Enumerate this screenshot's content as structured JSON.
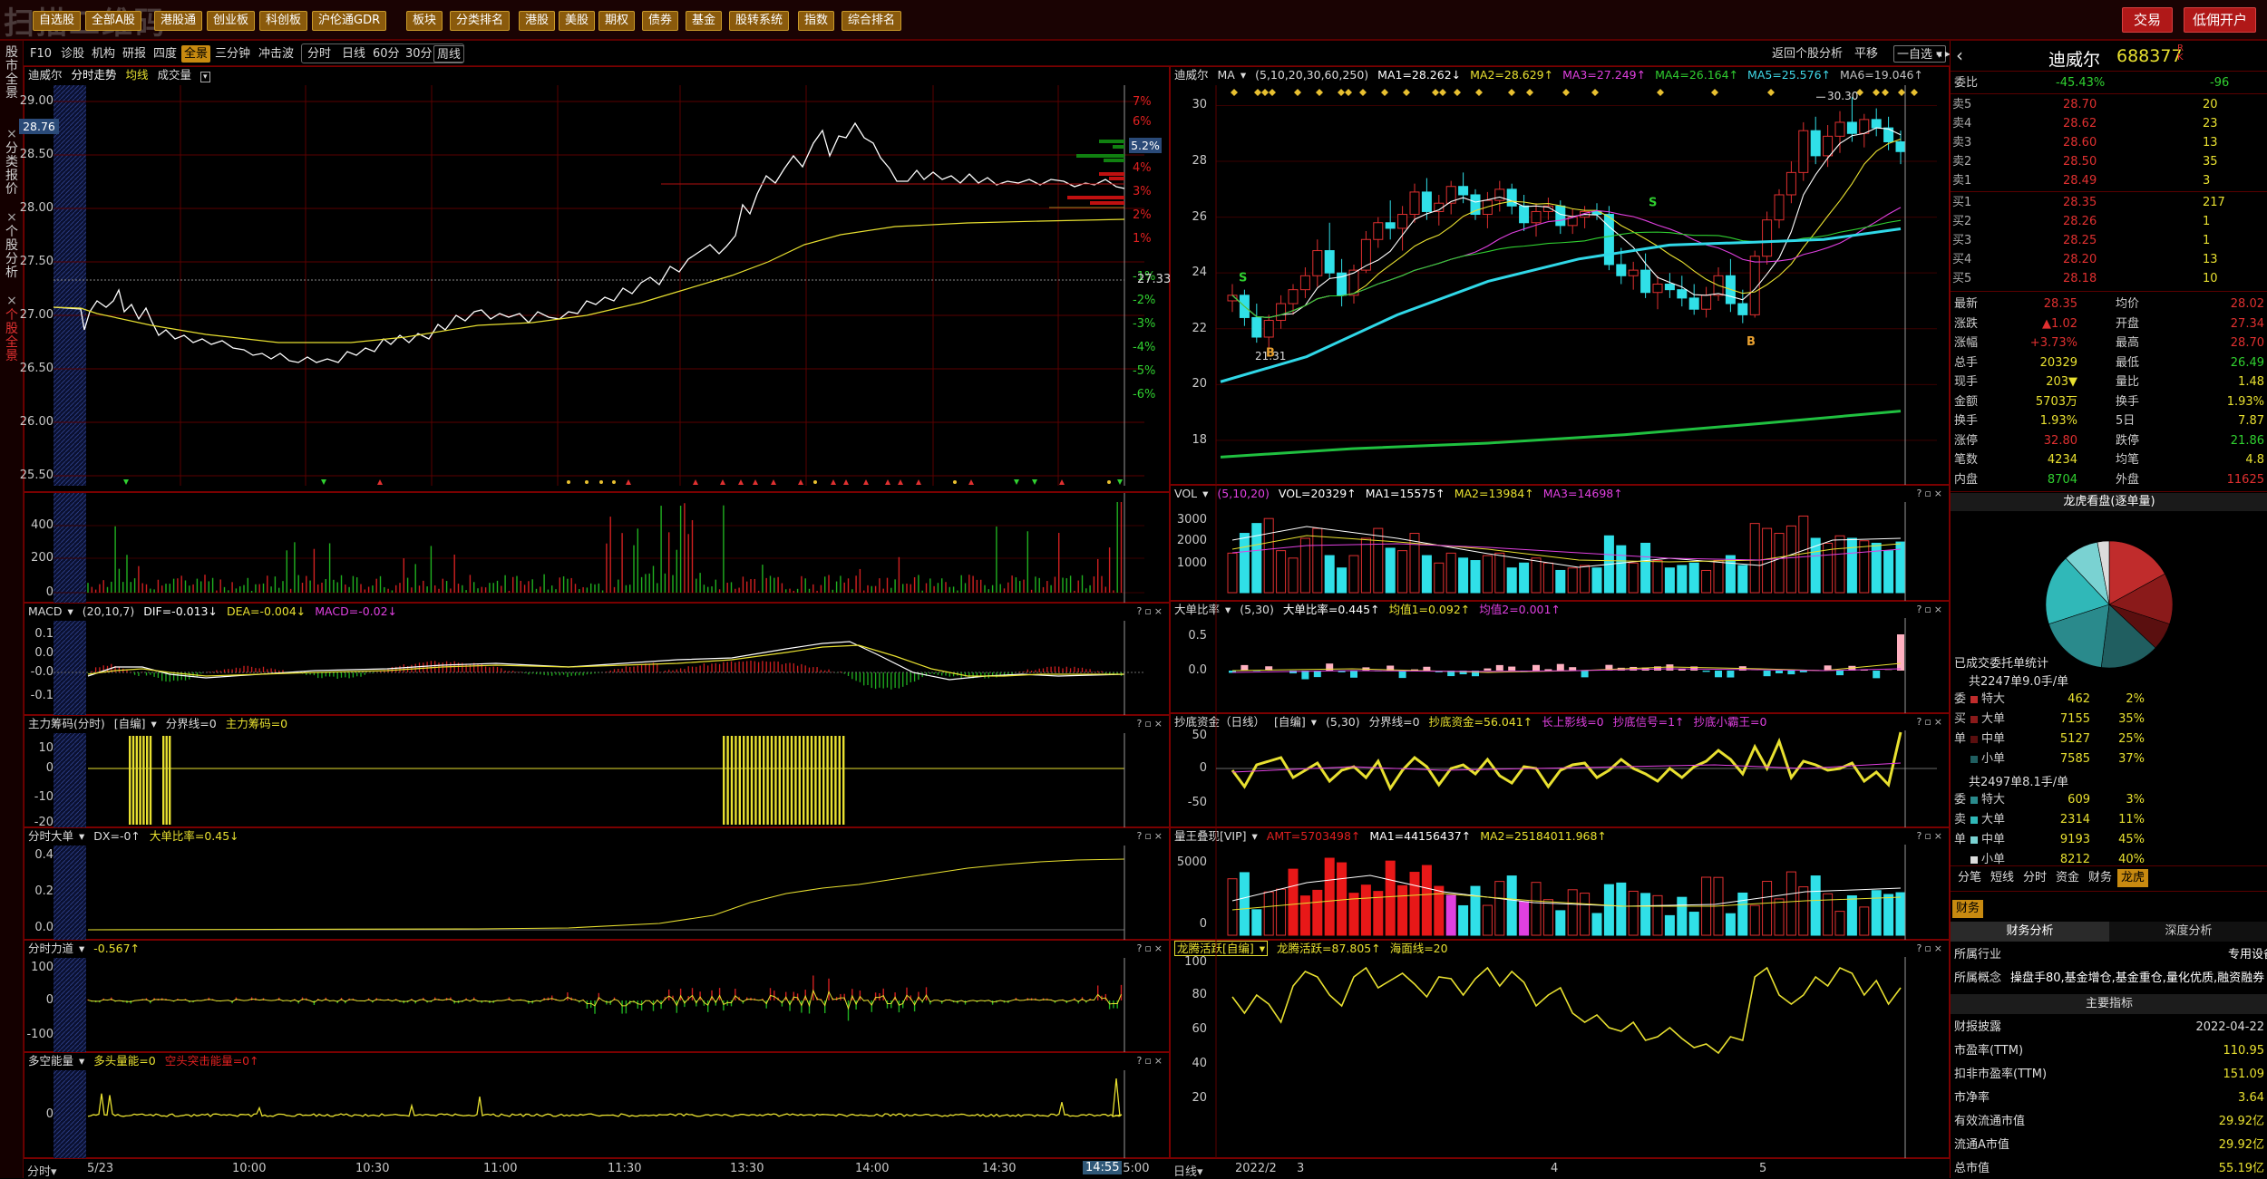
{
  "topbar": {
    "watermark": "扫描二维码",
    "menu": [
      "自选股",
      "全部A股",
      "港股通",
      "创业板",
      "科创板",
      "沪伦通GDR",
      "板块",
      "分类排名",
      "港股",
      "美股",
      "期权",
      "债券",
      "基金",
      "股转系统",
      "指数",
      "综合排名"
    ],
    "trade_btn": "交易",
    "open_btn": "低佣开户"
  },
  "left_tabs": [
    "股市全景",
    "分类报价",
    "个股分析",
    "个股全景"
  ],
  "toolbar2": {
    "items": [
      "F10",
      "诊股",
      "机构",
      "研报",
      "四度",
      "全景",
      "三分钟",
      "冲击波",
      "分时",
      "日线",
      "60分",
      "30分",
      "周线"
    ],
    "active": "全景",
    "right_items": [
      "返回个股分析",
      "平移",
      "一自选"
    ]
  },
  "intraday": {
    "header": {
      "name": "迪威尔",
      "title": "分时走势",
      "avg": "均线",
      "vol": "成交量"
    },
    "price_ticks": [
      "29.00",
      "28.50",
      "28.00",
      "27.50",
      "27.00",
      "26.50",
      "26.00",
      "25.50"
    ],
    "pct_ticks": [
      "7%",
      "6%",
      "5%",
      "4%",
      "3%",
      "2%",
      "1%",
      "-1%",
      "-2%",
      "-3%",
      "-4%",
      "-5%",
      "-6%"
    ],
    "price_box": "28.76",
    "pct_box": "5.2%",
    "preclose": "27.33",
    "vol_ticks": [
      "400",
      "200",
      "0"
    ]
  },
  "macd": {
    "name": "MACD",
    "params": "(20,10,7)",
    "dif": "DIF=-0.013↓",
    "dea": "DEA=-0.004↓",
    "macd": "MACD=-0.02↓",
    "ticks": [
      "0.1",
      "0.0",
      "-0.0",
      "-0.1"
    ]
  },
  "zl": {
    "name": "主力筹码(分时)",
    "sub": "[自编]",
    "line": "分界线=0",
    "val": "主力筹码=0",
    "ticks": [
      "10",
      "0",
      "-10",
      "-20"
    ]
  },
  "dd": {
    "name": "分时大单",
    "dx": "DX=-0↑",
    "ratio": "大单比率=0.45↓",
    "ticks": [
      "0.4",
      "0.2",
      "0.0"
    ]
  },
  "fl": {
    "name": "分时力道",
    "val": "-0.567↑",
    "ticks": [
      "100",
      "0",
      "-100"
    ]
  },
  "dk": {
    "name": "多空能量",
    "a": "多头量能=0",
    "b": "空头突击能量=0↑",
    "ticks": [
      "0"
    ]
  },
  "time_axis": {
    "label": "分时",
    "date": "5/23",
    "times": [
      "10:00",
      "10:30",
      "11:00",
      "11:30",
      "13:30",
      "14:00",
      "14:30",
      "15:00"
    ],
    "cursor": "14:55"
  },
  "kline": {
    "header": {
      "name": "迪威尔",
      "ma": "MA",
      "params": "(5,10,20,30,60,250)",
      "ma1": "MA1=28.262↓",
      "ma2": "MA2=28.629↑",
      "ma3": "MA3=27.249↑",
      "ma4": "MA4=26.164↑",
      "ma5": "MA5=25.576↑",
      "ma6": "MA6=19.046↑"
    },
    "ticks": [
      "30",
      "28",
      "26",
      "24",
      "22",
      "20",
      "18"
    ],
    "max_label": "30.30",
    "min_label": "21.31",
    "candles": [
      [
        23.0,
        23.6,
        22.6,
        23.2
      ],
      [
        23.2,
        23.4,
        22.1,
        22.4
      ],
      [
        22.4,
        22.9,
        21.5,
        21.7
      ],
      [
        21.7,
        22.5,
        21.31,
        22.3
      ],
      [
        22.3,
        23.2,
        22.0,
        22.9
      ],
      [
        22.9,
        23.6,
        22.5,
        23.4
      ],
      [
        23.4,
        24.2,
        23.1,
        23.9
      ],
      [
        23.9,
        25.2,
        23.5,
        24.8
      ],
      [
        24.8,
        25.8,
        23.8,
        24.0
      ],
      [
        24.0,
        24.5,
        22.8,
        23.2
      ],
      [
        23.2,
        24.3,
        22.9,
        24.1
      ],
      [
        24.1,
        25.5,
        24.0,
        25.2
      ],
      [
        25.2,
        26.0,
        24.9,
        25.8
      ],
      [
        25.8,
        26.6,
        25.2,
        25.6
      ],
      [
        25.6,
        26.4,
        24.8,
        26.1
      ],
      [
        26.1,
        27.2,
        25.8,
        26.9
      ],
      [
        26.9,
        27.4,
        25.9,
        26.2
      ],
      [
        26.2,
        26.8,
        25.7,
        26.5
      ],
      [
        26.5,
        27.3,
        26.1,
        27.1
      ],
      [
        27.1,
        27.6,
        26.5,
        26.8
      ],
      [
        26.8,
        27.0,
        25.9,
        26.1
      ],
      [
        26.1,
        26.9,
        25.6,
        26.6
      ],
      [
        26.6,
        27.3,
        26.2,
        27.0
      ],
      [
        27.0,
        27.2,
        26.1,
        26.4
      ],
      [
        26.4,
        26.8,
        25.5,
        25.8
      ],
      [
        25.8,
        26.5,
        25.3,
        26.2
      ],
      [
        26.2,
        26.7,
        25.9,
        26.4
      ],
      [
        26.4,
        26.6,
        25.4,
        25.7
      ],
      [
        25.7,
        26.3,
        25.4,
        26.0
      ],
      [
        26.0,
        26.4,
        25.6,
        26.2
      ],
      [
        26.2,
        26.5,
        25.9,
        26.1
      ],
      [
        26.1,
        26.4,
        24.1,
        24.3
      ],
      [
        24.3,
        24.9,
        23.6,
        23.9
      ],
      [
        23.9,
        24.4,
        23.4,
        24.1
      ],
      [
        24.1,
        24.7,
        23.1,
        23.3
      ],
      [
        23.3,
        23.9,
        22.7,
        23.6
      ],
      [
        23.6,
        24.0,
        23.1,
        23.4
      ],
      [
        23.4,
        23.9,
        22.8,
        23.1
      ],
      [
        23.1,
        23.6,
        22.5,
        22.7
      ],
      [
        22.7,
        23.5,
        22.4,
        23.2
      ],
      [
        23.2,
        24.2,
        23.0,
        23.9
      ],
      [
        23.9,
        24.5,
        22.6,
        22.9
      ],
      [
        22.9,
        23.4,
        22.2,
        22.5
      ],
      [
        22.5,
        24.8,
        22.4,
        24.6
      ],
      [
        24.6,
        26.2,
        24.3,
        25.9
      ],
      [
        25.9,
        27.0,
        25.6,
        26.8
      ],
      [
        26.8,
        28.0,
        26.5,
        27.6
      ],
      [
        27.6,
        29.4,
        27.3,
        29.1
      ],
      [
        29.1,
        29.6,
        27.9,
        28.2
      ],
      [
        28.2,
        29.3,
        27.8,
        28.9
      ],
      [
        28.9,
        29.8,
        28.3,
        29.4
      ],
      [
        29.4,
        30.3,
        28.7,
        29.0
      ],
      [
        29.0,
        29.7,
        28.5,
        29.5
      ],
      [
        29.5,
        29.9,
        28.9,
        29.2
      ],
      [
        29.2,
        29.6,
        28.4,
        28.7
      ],
      [
        28.7,
        29.1,
        27.9,
        28.35
      ]
    ],
    "date_label": "日线",
    "dates": [
      "2022/2",
      "3",
      "4",
      "5"
    ]
  },
  "vol": {
    "name": "VOL",
    "params": "(5,10,20)",
    "val": "VOL=20329↑",
    "ma1": "MA1=15575↑",
    "ma2": "MA2=13984↑",
    "ma3": "MA3=14698↑",
    "ticks": [
      "3000",
      "2000",
      "1000"
    ]
  },
  "ddbl": {
    "name": "大单比率",
    "params": "(5,30)",
    "val": "大单比率=0.445↑",
    "j1": "均值1=0.092↑",
    "j2": "均值2=0.001↑",
    "ticks": [
      "0.5",
      "0.0"
    ]
  },
  "cdzj": {
    "name": "抄底资金（日线）",
    "sub": "[自编]",
    "params": "(5,30)",
    "a": "分界线=0",
    "b": "抄底资金=56.041↑",
    "c": "长上影线=0",
    "d": "抄底信号=1↑",
    "e": "抄底小霸王=0",
    "ticks": [
      "50",
      "0",
      "-50"
    ]
  },
  "lwdx": {
    "name": "量王叠现[VIP]",
    "amt": "AMT=5703498↑",
    "ma1": "MA1=44156437↑",
    "ma2": "MA2=25184011.968↑",
    "ticks": [
      "5000",
      "0"
    ]
  },
  "lthy": {
    "name": "龙腾活跃[自编]",
    "a": "龙腾活跃=87.805↑",
    "b": "海面线=20",
    "ticks": [
      "100",
      "80",
      "60",
      "40",
      "20"
    ]
  },
  "right": {
    "name": "迪威尔",
    "code": "688377",
    "tag": "R K",
    "weibi_label": "委比",
    "weibi": "-45.43%",
    "weicha": "-96",
    "sell": [
      [
        "卖5",
        "28.70",
        "20"
      ],
      [
        "卖4",
        "28.62",
        "23"
      ],
      [
        "卖3",
        "28.60",
        "13"
      ],
      [
        "卖2",
        "28.50",
        "35"
      ],
      [
        "卖1",
        "28.49",
        "3"
      ]
    ],
    "buy": [
      [
        "买1",
        "28.35",
        "217"
      ],
      [
        "买2",
        "28.26",
        "1"
      ],
      [
        "买3",
        "28.25",
        "1"
      ],
      [
        "买4",
        "28.20",
        "13"
      ],
      [
        "买5",
        "28.18",
        "10"
      ]
    ],
    "quote": [
      [
        "最新",
        "28.35",
        "均价",
        "28.02"
      ],
      [
        "涨跌",
        "▲1.02",
        "开盘",
        "27.34"
      ],
      [
        "涨幅",
        "+3.73%",
        "最高",
        "28.70"
      ],
      [
        "总手",
        "20329",
        "最低",
        "26.49"
      ],
      [
        "现手",
        "203▼",
        "量比",
        "1.48"
      ],
      [
        "金额",
        "5703万",
        "换手",
        "1.93%"
      ],
      [
        "换手",
        "1.93%",
        "5日",
        "7.87"
      ],
      [
        "涨停",
        "32.80",
        "跌停",
        "21.86"
      ],
      [
        "笔数",
        "4234",
        "均笔",
        "4.8"
      ],
      [
        "内盘",
        "8704",
        "外盘",
        "11625"
      ]
    ],
    "lhk_title": "龙虎看盘(逐单量)",
    "pie_colors": [
      "#c02c2c",
      "#8a1a1a",
      "#5a0f0f",
      "#205e60",
      "#2a8a8c",
      "#30b8b8",
      "#7ad2d2",
      "#dcdcdc"
    ],
    "pie_values": [
      17,
      13,
      7,
      15,
      18,
      18,
      9,
      3
    ],
    "entrust_title": "已成交委托单统计",
    "b_title": "共2247单9.0手/单",
    "buy_stat": [
      [
        "特大",
        "462",
        "2%"
      ],
      [
        "大单",
        "7155",
        "35%"
      ],
      [
        "中单",
        "5127",
        "25%"
      ],
      [
        "小单",
        "7585",
        "37%"
      ]
    ],
    "s_title": "共2497单8.1手/单",
    "sell_stat": [
      [
        "特大",
        "609",
        "3%"
      ],
      [
        "大单",
        "2314",
        "11%"
      ],
      [
        "中单",
        "9193",
        "45%"
      ],
      [
        "小单",
        "8212",
        "40%"
      ]
    ],
    "side_b": [
      "委",
      "买",
      "单"
    ],
    "side_s": [
      "委",
      "卖",
      "单"
    ],
    "tabs": [
      "分笔",
      "短线",
      "分时",
      "资金",
      "财务",
      "龙虎"
    ],
    "fin_tab": "财务",
    "fin_subtabs": [
      "财务分析",
      "深度分析"
    ],
    "fin_rows": [
      [
        "所属行业",
        "专用设备"
      ],
      [
        "所属概念",
        "操盘手80,基金增仓,基金重仓,量化优质,融资融券"
      ]
    ],
    "main_title": "主要指标",
    "fin_metrics": [
      [
        "财报披露",
        "2022-04-22"
      ],
      [
        "市盈率(TTM)",
        "110.95"
      ],
      [
        "扣非市盈率(TTM)",
        "151.09"
      ],
      [
        "市净率",
        "3.64"
      ],
      [
        "有效流通市值",
        "29.92亿"
      ],
      [
        "流通A市值",
        "29.92亿"
      ],
      [
        "总市值",
        "55.19亿"
      ]
    ]
  }
}
